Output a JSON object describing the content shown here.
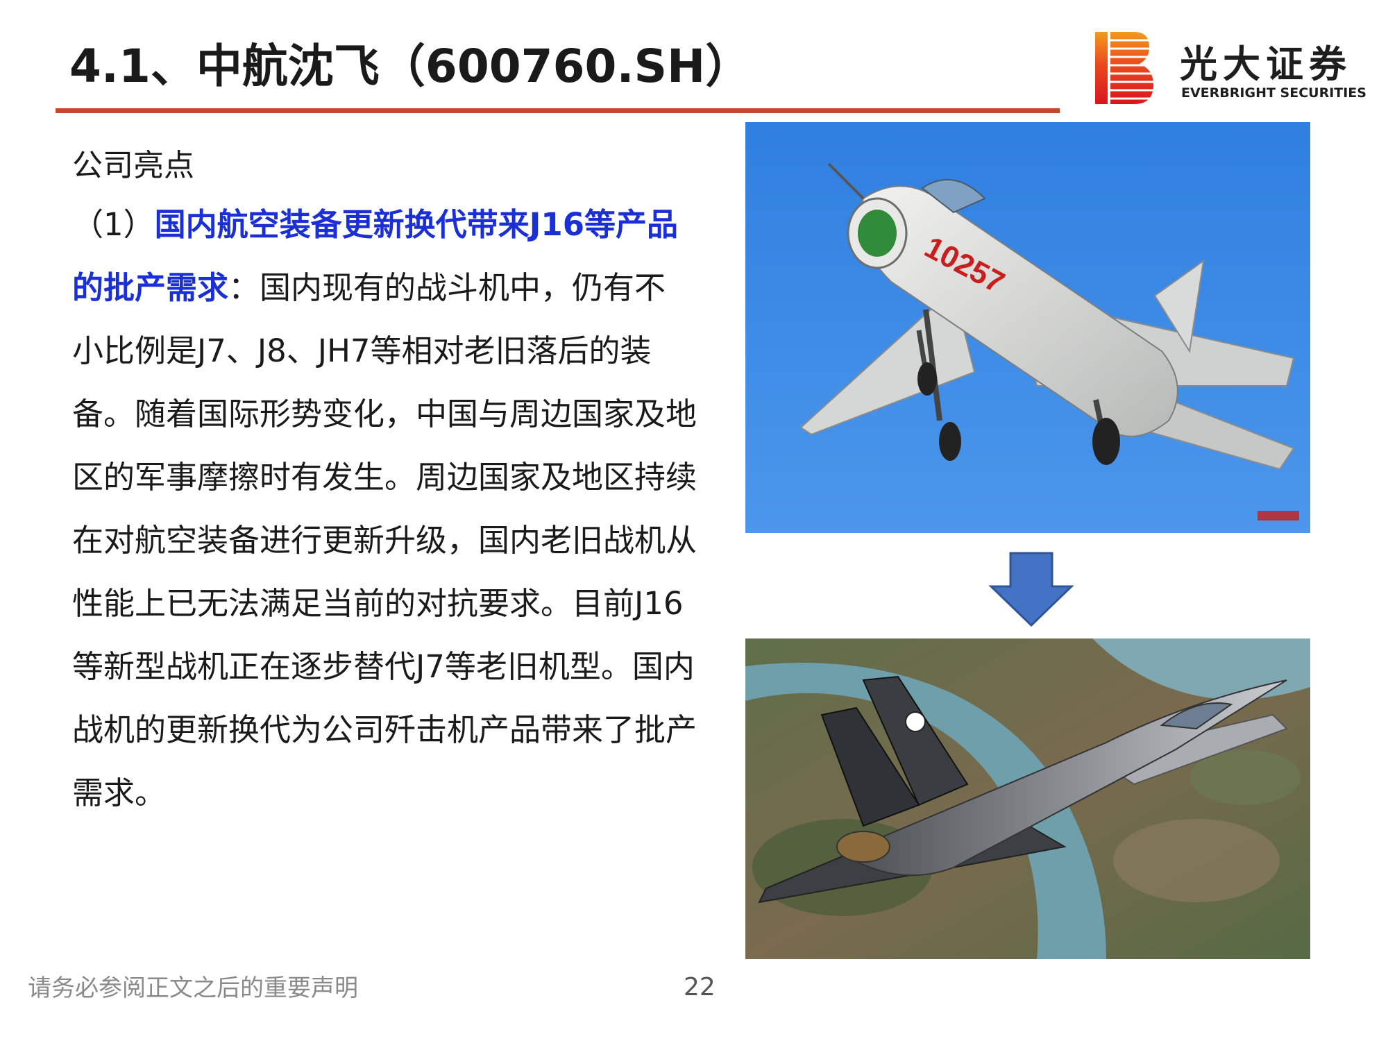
{
  "header": {
    "title": "4.1、中航沈飞（600760.SH）",
    "logo_cn": "光大证券",
    "logo_en": "EVERBRIGHT SECURITIES"
  },
  "content": {
    "section_label": "公司亮点",
    "point_prefix": "（1）",
    "point_heading": "国内航空装备更新换代带来J16等产品的批产需求",
    "point_colon": "：",
    "point_body": "国内现有的战斗机中，仍有不小比例是J7、J8、JH7等相对老旧落后的装备。随着国际形势变化，中国与周边国家及地区的军事摩擦时有发生。周边国家及地区持续在对航空装备进行更新升级，国内老旧战机从性能上已无法满足当前的对抗要求。目前J16等新型战机正在逐步替代J7等老旧机型。国内战机的更新换代为公司歼击机产品带来了批产需求。"
  },
  "images": {
    "top_photo": "J-7 fighter jet in blue sky",
    "top_photo_marking": "10257",
    "bottom_photo": "J-16 fighter jet over river and mountains"
  },
  "footer": {
    "note": "请务必参阅正文之后的重要声明",
    "page_number": "22"
  },
  "colors": {
    "title_rule": "#c5482b",
    "highlight": "#1a2fd6",
    "arrow": "#4472c4",
    "logo_red": "#e0301e",
    "logo_orange": "#f39a1e"
  }
}
